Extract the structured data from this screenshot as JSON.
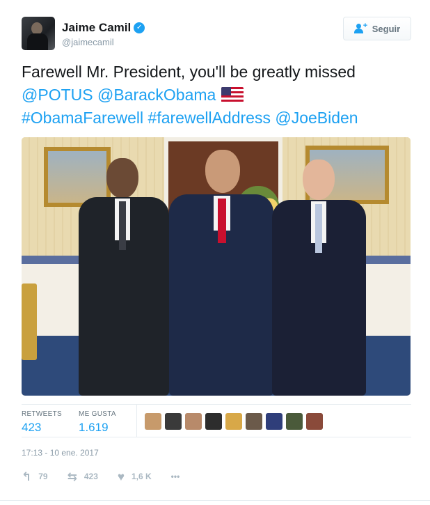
{
  "author": {
    "display_name": "Jaime Camil",
    "handle": "@jaimecamil",
    "verified_icon": "✓"
  },
  "follow_button": {
    "label": "Seguir"
  },
  "tweet": {
    "text": "Farewell Mr. President, you'll be greatly missed",
    "mentions_line": [
      "@POTUS",
      "@BarackObama"
    ],
    "hashtags_line": [
      "#ObamaFarewell",
      "#farewellAddress",
      "@JoeBiden"
    ],
    "flag_icon": "us-flag-icon"
  },
  "stats": {
    "retweets_label": "RETWEETS",
    "retweets_value": "423",
    "likes_label": "ME GUSTA",
    "likes_value": "1.619",
    "liker_colors": [
      "#c79a6b",
      "#3a3a3a",
      "#b88a6a",
      "#2d2d2d",
      "#d8a848",
      "#6b5a4a",
      "#2f3e7a",
      "#4a5a3a",
      "#8a4a3a"
    ]
  },
  "timestamp": "17:13 - 10 ene. 2017",
  "actions": {
    "reply_count": "79",
    "retweet_count": "423",
    "like_count": "1,6 K",
    "more_label": "•••"
  },
  "colors": {
    "link": "#1da1f2",
    "muted": "#8899a6",
    "icon": "#aab8c2"
  }
}
